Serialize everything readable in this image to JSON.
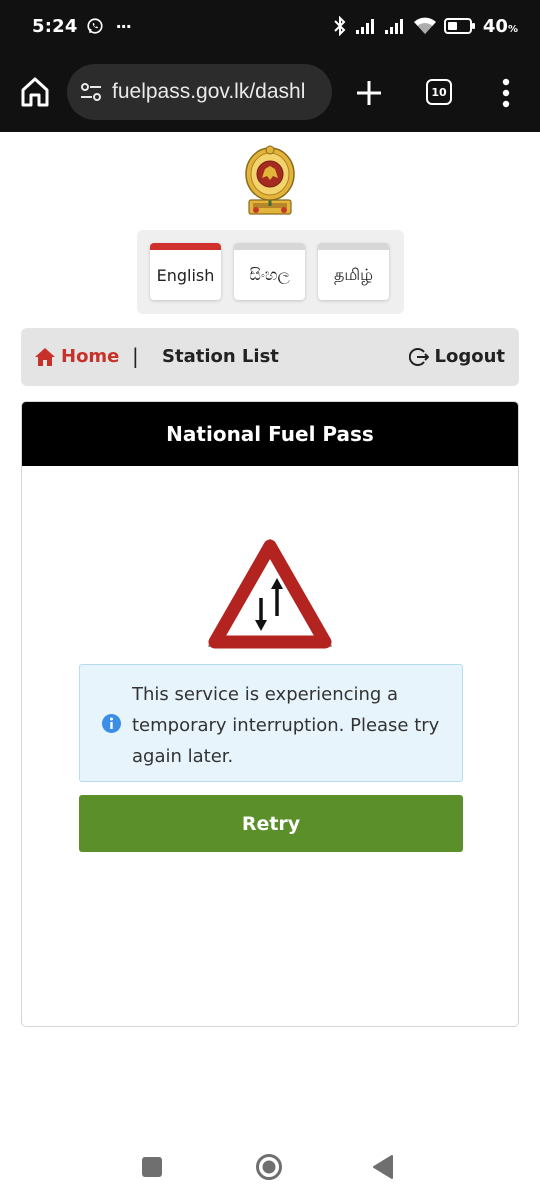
{
  "status_bar": {
    "time": "5:24",
    "more": "···",
    "battery": "40",
    "battery_unit": "%"
  },
  "browser": {
    "url": "fuelpass.gov.lk/dashl",
    "tab_count": "10"
  },
  "languages": [
    {
      "label": "English",
      "active": true
    },
    {
      "label": "සිංහල",
      "active": false
    },
    {
      "label": "தமிழ்",
      "active": false
    }
  ],
  "nav": {
    "home": "Home",
    "separator": "|",
    "station_list": "Station List",
    "logout": "Logout"
  },
  "card": {
    "title": "National Fuel Pass",
    "message": "This service is experiencing a temporary interruption. Please try again later.",
    "retry_label": "Retry"
  },
  "colors": {
    "accent_red": "#d0312d",
    "retry_green": "#5b8f2a",
    "alert_bg": "#e7f4fb",
    "header_bg": "#000000"
  }
}
